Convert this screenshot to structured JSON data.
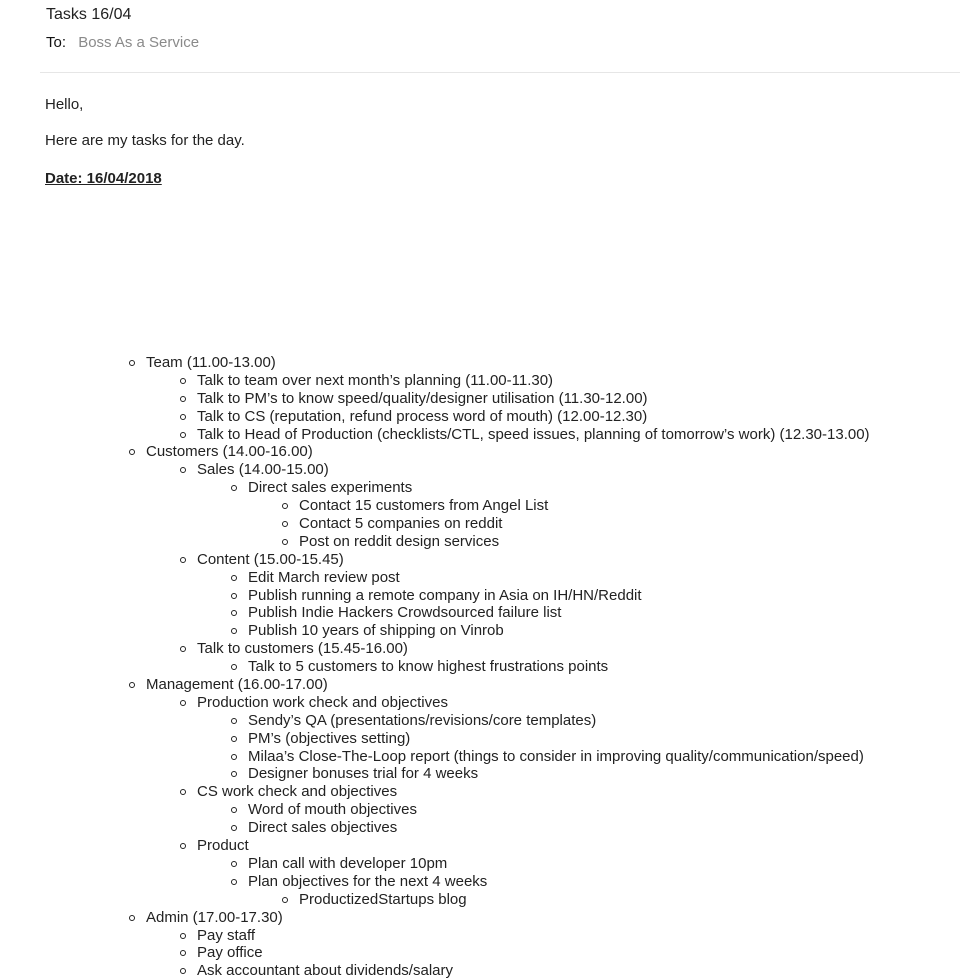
{
  "email": {
    "subject": "Tasks 16/04",
    "to_label": "To:",
    "to_value": "Boss As a Service",
    "greeting": "Hello,",
    "intro": "Here are my tasks for the day.",
    "date_line": "Date: 16/04/2018"
  },
  "tasks": [
    {
      "level": 1,
      "text": "Team (11.00-13.00)"
    },
    {
      "level": 2,
      "text": "Talk to team over next month’s planning (11.00-11.30)"
    },
    {
      "level": 2,
      "text": "Talk to PM’s to know speed/quality/designer utilisation (11.30-12.00)"
    },
    {
      "level": 2,
      "text": "Talk to CS (reputation, refund process word of mouth) (12.00-12.30)"
    },
    {
      "level": 2,
      "text": "Talk to Head of Production (checklists/CTL, speed issues, planning of tomorrow’s work) (12.30-13.00)"
    },
    {
      "level": 1,
      "text": "Customers (14.00-16.00)"
    },
    {
      "level": 2,
      "text": "Sales  (14.00-15.00)"
    },
    {
      "level": 3,
      "text": "Direct sales experiments"
    },
    {
      "level": 4,
      "text": "Contact 15 customers from Angel List"
    },
    {
      "level": 4,
      "text": "Contact 5 companies on reddit"
    },
    {
      "level": 4,
      "text": "Post on reddit design services"
    },
    {
      "level": 2,
      "text": "Content (15.00-15.45)"
    },
    {
      "level": 3,
      "text": "Edit March review post"
    },
    {
      "level": 3,
      "text": "Publish running a remote company in Asia on IH/HN/Reddit"
    },
    {
      "level": 3,
      "text": "Publish Indie Hackers Crowdsourced failure list"
    },
    {
      "level": 3,
      "text": "Publish 10 years of shipping on Vinrob"
    },
    {
      "level": 2,
      "text": "Talk to customers (15.45-16.00)"
    },
    {
      "level": 3,
      "text": "Talk to 5 customers to know highest frustrations points"
    },
    {
      "level": 1,
      "text": "Management (16.00-17.00)"
    },
    {
      "level": 2,
      "text": "Production work check and objectives"
    },
    {
      "level": 3,
      "text": "Sendy’s QA (presentations/revisions/core templates)"
    },
    {
      "level": 3,
      "text": "PM’s (objectives setting)"
    },
    {
      "level": 3,
      "text": "Milaa’s Close-The-Loop report (things to consider in improving quality/communication/speed)"
    },
    {
      "level": 3,
      "text": "Designer bonuses trial for 4 weeks"
    },
    {
      "level": 2,
      "text": "CS work check and objectives"
    },
    {
      "level": 3,
      "text": "Word of mouth objectives"
    },
    {
      "level": 3,
      "text": "Direct sales objectives"
    },
    {
      "level": 2,
      "text": "Product"
    },
    {
      "level": 3,
      "text": "Plan call with developer 10pm"
    },
    {
      "level": 3,
      "text": "Plan objectives for the next 4 weeks"
    },
    {
      "level": 4,
      "text": "ProductizedStartups blog"
    },
    {
      "level": 1,
      "text": "Admin (17.00-17.30)"
    },
    {
      "level": 2,
      "text": "Pay staff"
    },
    {
      "level": 2,
      "text": "Pay office"
    },
    {
      "level": 2,
      "text": "Ask accountant about dividends/salary"
    }
  ]
}
